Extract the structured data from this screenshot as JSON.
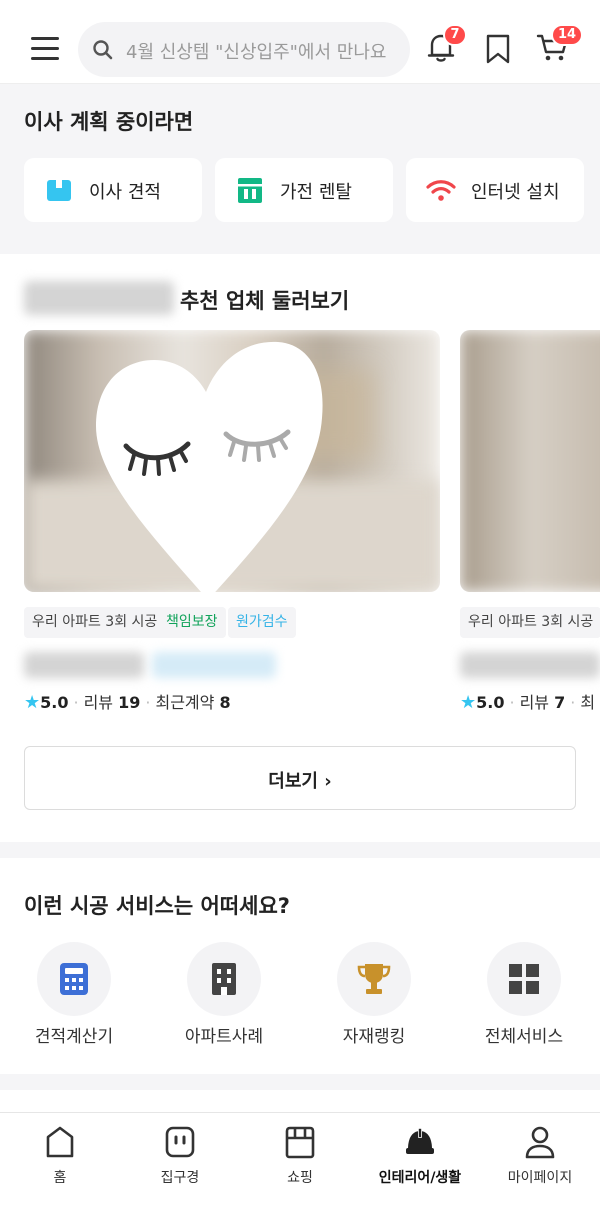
{
  "colors": {
    "accent": "#35c5f0",
    "badge": "#ff4a4a",
    "green": "#12b886",
    "background_gray": "#f5f5f7"
  },
  "header": {
    "search_placeholder": "4월 신상템 \"신상입주\"에서 만나요",
    "notification_count": "7",
    "cart_count": "14",
    "icons": [
      "menu-icon",
      "search-icon",
      "bell-icon",
      "bookmark-icon",
      "cart-icon"
    ]
  },
  "moving": {
    "title": "이사 계획 중이라면",
    "items": [
      {
        "label": "이사 견적",
        "icon": "box-icon"
      },
      {
        "label": "가전 렌탈",
        "icon": "rental-icon"
      },
      {
        "label": "인터넷 설치",
        "icon": "wifi-icon"
      }
    ]
  },
  "vendors": {
    "title": "추천 업체 둘러보기",
    "cards": [
      {
        "tags": [
          "우리 아파트 3회 시공",
          "책임보장",
          "원가검수"
        ],
        "rating": "5.0",
        "review_label": "리뷰",
        "review_count": "19",
        "contract_label": "최근계약",
        "contract_count": "8"
      },
      {
        "tags": [
          "우리 아파트 3회 시공"
        ],
        "rating": "5.0",
        "review_label": "리뷰",
        "review_count": "7",
        "contract_label": "최"
      }
    ],
    "more_label": "더보기"
  },
  "services": {
    "title": "이런 시공 서비스는 어떠세요?",
    "items": [
      {
        "label": "견적계산기",
        "icon": "calculator-icon"
      },
      {
        "label": "아파트사례",
        "icon": "apartment-icon"
      },
      {
        "label": "자재랭킹",
        "icon": "trophy-icon"
      },
      {
        "label": "전체서비스",
        "icon": "grid-icon"
      }
    ]
  },
  "bottom_nav": [
    {
      "label": "홈",
      "icon": "home-icon",
      "active": false
    },
    {
      "label": "집구경",
      "icon": "house-tour-icon",
      "active": false
    },
    {
      "label": "쇼핑",
      "icon": "shop-icon",
      "active": false
    },
    {
      "label": "인테리어/생활",
      "icon": "helmet-icon",
      "active": true
    },
    {
      "label": "마이페이지",
      "icon": "person-icon",
      "active": false
    }
  ]
}
